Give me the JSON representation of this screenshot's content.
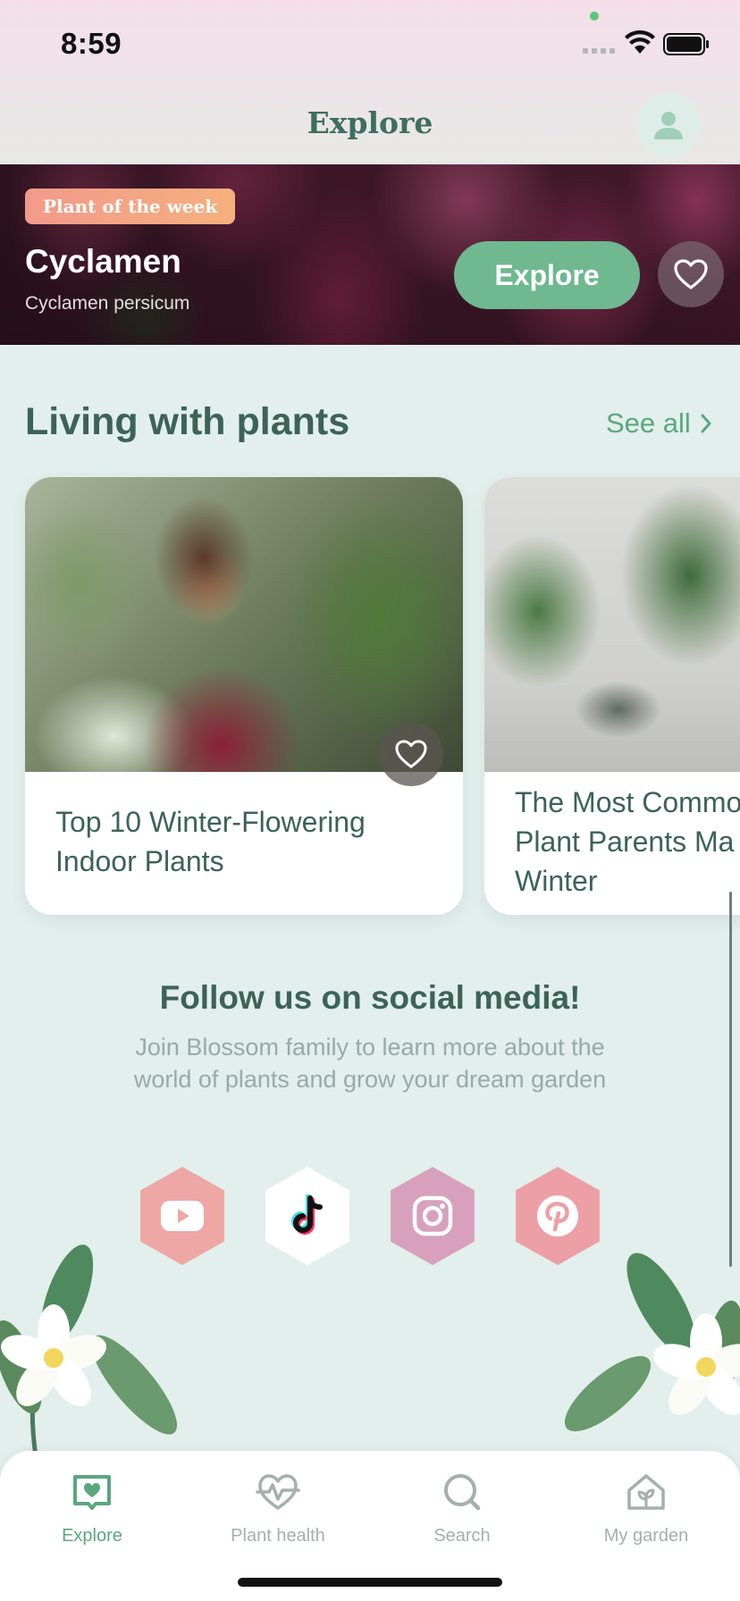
{
  "status_bar": {
    "time": "8:59"
  },
  "header": {
    "title": "Explore"
  },
  "hero": {
    "badge": "Plant of the week",
    "name": "Cyclamen",
    "latin": "Cyclamen persicum",
    "explore_label": "Explore"
  },
  "section": {
    "title": "Living with plants",
    "see_all": "See all",
    "cards": [
      {
        "title": "Top 10 Winter-Flowering Indoor Plants"
      },
      {
        "title_lines": [
          "The Most Commo",
          "Plant Parents Ma",
          "Winter"
        ]
      }
    ]
  },
  "social": {
    "title": "Follow us on social media!",
    "text": "Join Blossom family to learn more about the world of plants and grow your dream garden",
    "icons": [
      "youtube-icon",
      "tiktok-icon",
      "instagram-icon",
      "pinterest-icon"
    ],
    "colors": {
      "youtube": "#eea7a4",
      "tiktok": "#ffffff",
      "instagram": "#d7a1bd",
      "pinterest": "#ec9fa4"
    }
  },
  "tabbar": {
    "items": [
      {
        "label": "Explore",
        "icon": "book-heart-icon",
        "active": true
      },
      {
        "label": "Plant health",
        "icon": "heart-pulse-icon",
        "active": false
      },
      {
        "label": "Search",
        "icon": "search-icon",
        "active": false
      },
      {
        "label": "My garden",
        "icon": "home-leaf-icon",
        "active": false
      }
    ]
  },
  "colors": {
    "accent": "#5aa77e",
    "background": "#e2efec",
    "text": "#3c6356"
  }
}
